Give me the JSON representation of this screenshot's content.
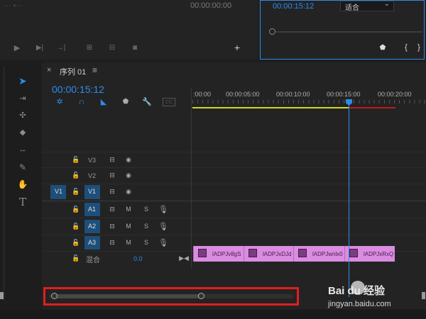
{
  "source_monitor": {
    "timecode": "00:00:00:00"
  },
  "program_monitor": {
    "timecode": "00:00:15:12",
    "fit_label": "适合",
    "fit_arrow": "⌄"
  },
  "sequence": {
    "close_glyph": "×",
    "title": "序列 01",
    "menu_glyph": "≡",
    "timecode": "00:00:15:12",
    "ruler_ticks": [
      ":00:00",
      "00:00:05:00",
      "00:00:10:00",
      "00:00:15:00",
      "00:00:20:00"
    ]
  },
  "video_tracks": [
    {
      "source": "",
      "name": "V3"
    },
    {
      "source": "",
      "name": "V2"
    },
    {
      "source": "V1",
      "name": "V1"
    }
  ],
  "audio_tracks": [
    {
      "name": "A1",
      "m": "M",
      "s": "S"
    },
    {
      "name": "A2",
      "m": "M",
      "s": "S"
    },
    {
      "name": "A3",
      "m": "M",
      "s": "S"
    }
  ],
  "mix": {
    "label": "混合",
    "value": "0.0"
  },
  "clips": [
    {
      "label": "lADPJv8gS"
    },
    {
      "label": "lADPJxDJd"
    },
    {
      "label": "lADPJwnlx0"
    },
    {
      "label": "lADPJxRxQ"
    }
  ],
  "watermark": {
    "brand": "Bai du 经验",
    "url": "jingyan.baidu.com"
  },
  "colors": {
    "accent": "#2d8ceb",
    "clip": "#d98ce0",
    "highlight": "#e01e1e",
    "work_area": "#d6d61e"
  }
}
